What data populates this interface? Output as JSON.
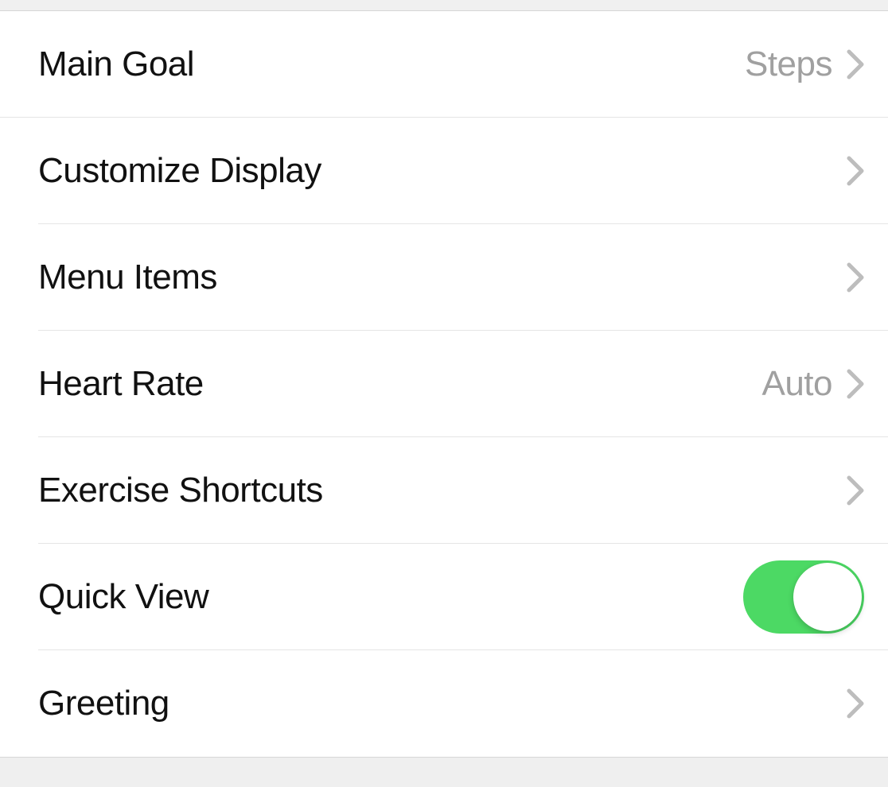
{
  "settings": {
    "rows": [
      {
        "id": "main-goal",
        "label": "Main Goal",
        "value": "Steps",
        "type": "nav"
      },
      {
        "id": "customize-display",
        "label": "Customize Display",
        "value": "",
        "type": "nav"
      },
      {
        "id": "menu-items",
        "label": "Menu Items",
        "value": "",
        "type": "nav"
      },
      {
        "id": "heart-rate",
        "label": "Heart Rate",
        "value": "Auto",
        "type": "nav"
      },
      {
        "id": "exercise-shortcuts",
        "label": "Exercise Shortcuts",
        "value": "",
        "type": "nav"
      },
      {
        "id": "quick-view",
        "label": "Quick View",
        "value": "",
        "type": "toggle",
        "on": true
      },
      {
        "id": "greeting",
        "label": "Greeting",
        "value": "",
        "type": "nav"
      }
    ]
  },
  "colors": {
    "toggle_on": "#4cd964",
    "chevron": "#bdbdbd",
    "value_text": "#a0a0a0"
  }
}
